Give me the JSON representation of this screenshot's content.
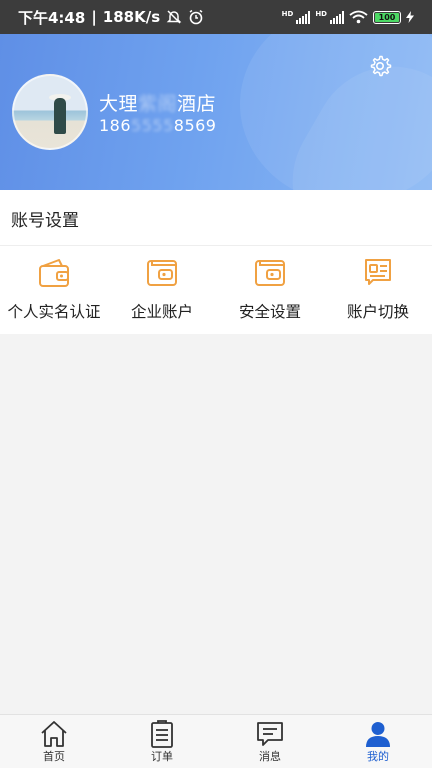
{
  "status_bar": {
    "time": "下午4:48",
    "speed": "188K/s",
    "network_label_1": "HD",
    "network_label_2": "HD",
    "battery": "100"
  },
  "profile": {
    "name_prefix": "大理",
    "name_hidden": "紫阁",
    "name_suffix": "酒店",
    "phone_prefix": "186",
    "phone_hidden": "5555",
    "phone_suffix": "8569"
  },
  "account_settings": {
    "title": "账号设置",
    "items": [
      {
        "label": "个人实名认证",
        "icon": "id-card-wallet-icon"
      },
      {
        "label": "企业账户",
        "icon": "wallet-icon"
      },
      {
        "label": "安全设置",
        "icon": "wallet-icon"
      },
      {
        "label": "账户切换",
        "icon": "card-icon"
      }
    ]
  },
  "tabbar": {
    "tabs": [
      {
        "label": "首页",
        "icon": "home-icon"
      },
      {
        "label": "订单",
        "icon": "order-icon"
      },
      {
        "label": "消息",
        "icon": "message-icon"
      },
      {
        "label": "我的",
        "icon": "user-icon",
        "active": true
      }
    ]
  },
  "colors": {
    "accent": "#1e5fd0",
    "icon_orange": "#f0a142",
    "header_blue": "#6fa2ef"
  }
}
